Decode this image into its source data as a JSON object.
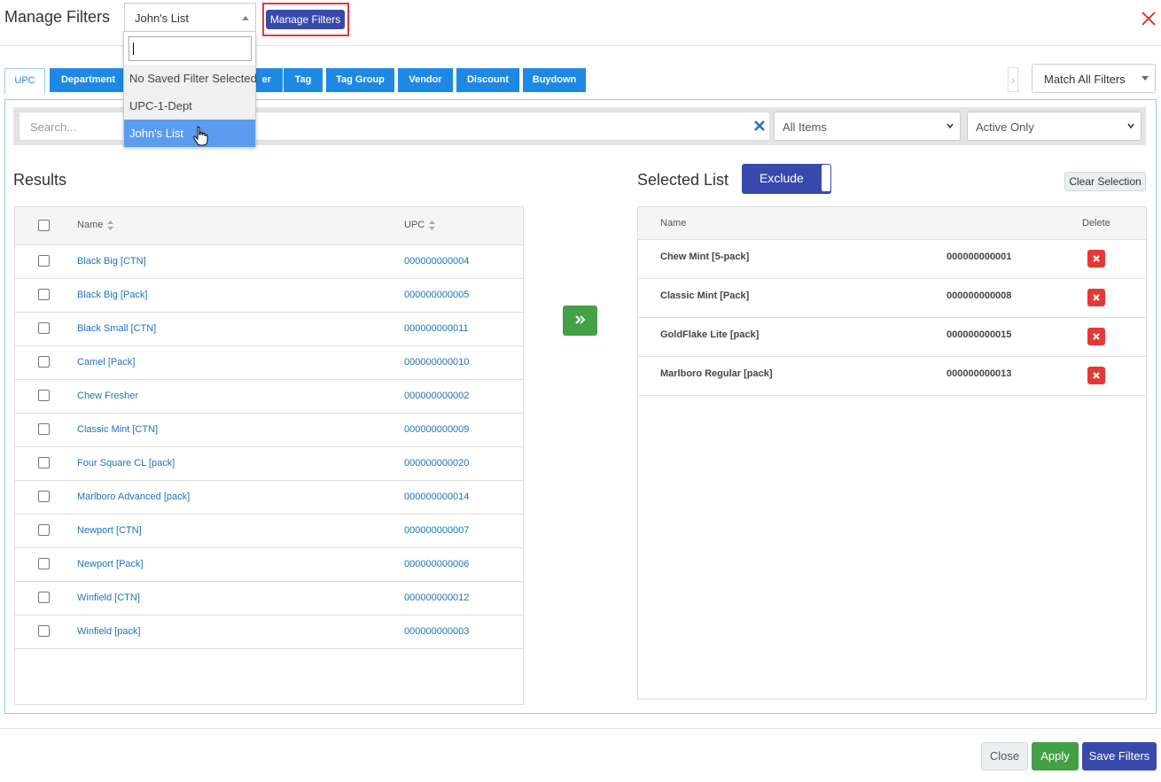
{
  "dialog": {
    "title": "Manage Filters",
    "saved_filter_value": "John's List",
    "manage_filters_button": "Manage Filters"
  },
  "saved_filter_dropdown": {
    "search_value": "",
    "options": [
      "No Saved Filter Selected",
      "UPC-1-Dept",
      "John's List"
    ],
    "selected": "John's List"
  },
  "tabs": [
    {
      "label": "UPC",
      "active": true
    },
    {
      "label": "Department",
      "active": false
    },
    {
      "label": "er",
      "active": false
    },
    {
      "label": "Tag",
      "active": false
    },
    {
      "label": "Tag Group",
      "active": false
    },
    {
      "label": "Vendor",
      "active": false
    },
    {
      "label": "Discount",
      "active": false
    },
    {
      "label": "Buydown",
      "active": false
    }
  ],
  "match_filter": "Match All Filters",
  "search": {
    "placeholder": "Search...",
    "items_filter": "All Items",
    "status_filter": "Active Only"
  },
  "results": {
    "title": "Results",
    "columns": [
      "Name",
      "UPC"
    ],
    "rows": [
      {
        "name": "Black Big [CTN]",
        "upc": "000000000004"
      },
      {
        "name": "Black Big [Pack]",
        "upc": "000000000005"
      },
      {
        "name": "Black Small [CTN]",
        "upc": "000000000011"
      },
      {
        "name": "Camel [Pack]",
        "upc": "000000000010"
      },
      {
        "name": "Chew Fresher",
        "upc": "000000000002"
      },
      {
        "name": "Classic Mint [CTN]",
        "upc": "000000000009"
      },
      {
        "name": "Four Square CL [pack]",
        "upc": "000000000020"
      },
      {
        "name": "Marlboro Advanced [pack]",
        "upc": "000000000014"
      },
      {
        "name": "Newport [CTN]",
        "upc": "000000000007"
      },
      {
        "name": "Newport [Pack]",
        "upc": "000000000006"
      },
      {
        "name": "Winfield [CTN]",
        "upc": "000000000012"
      },
      {
        "name": "Winfield [pack]",
        "upc": "000000000003"
      }
    ]
  },
  "selected_list": {
    "title": "Selected List",
    "exclude_label": "Exclude",
    "clear_selection": "Clear Selection",
    "columns": [
      "Name",
      "Delete"
    ],
    "rows": [
      {
        "name": "Chew Mint [5-pack]",
        "upc": "000000000001"
      },
      {
        "name": "Classic Mint [Pack]",
        "upc": "000000000008"
      },
      {
        "name": "GoldFlake Lite [pack]",
        "upc": "000000000015"
      },
      {
        "name": "Marlboro Regular [pack]",
        "upc": "000000000013"
      }
    ]
  },
  "footer": {
    "close": "Close",
    "apply": "Apply",
    "save_filters": "Save Filters"
  },
  "colors": {
    "primary": "#3949ab",
    "tab_blue": "#1e88e5",
    "success": "#43a047",
    "danger": "#e53935",
    "link": "#1e73be",
    "dropdown_selected": "#5b9cf0"
  }
}
